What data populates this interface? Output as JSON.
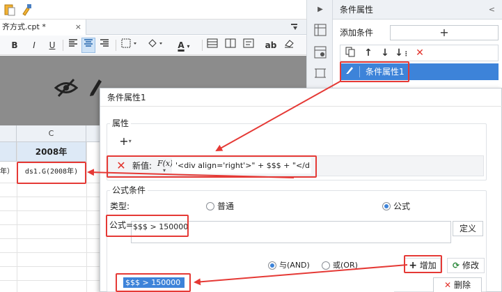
{
  "editor": {
    "file_tab": "齐方式.cpt *",
    "file_tab_close": "×",
    "format_toolbar": {
      "bold": "B",
      "italic": "I",
      "underline": "U",
      "font_color": "A",
      "ab": "ab"
    }
  },
  "sheet": {
    "column_c_header": "C",
    "left_cell_text": "年）",
    "header_cell": "2008年",
    "data_cell": "ds1.G(2008年)"
  },
  "right_panel": {
    "title": "条件属性",
    "collapse_glyph": "<",
    "add_condition_label": "添加条件",
    "add_button": "+",
    "toolbar": {
      "copy_icon": "copy-icon",
      "up": "↑",
      "down": "↓",
      "move_bottom": "↓",
      "delete": "✕"
    },
    "selected_item": "条件属性1"
  },
  "dialog": {
    "title": "条件属性1",
    "attribute_group_label": "属性",
    "add_attribute": "+",
    "new_value_label": "新值:",
    "fx_label": "F(x)",
    "new_value": "'<div align='right'>\" + $$$ + \"</div>\")",
    "formula_group_label": "公式条件",
    "type_label": "类型:",
    "type_options": [
      {
        "label": "普通",
        "selected": false
      },
      {
        "label": "公式",
        "selected": true
      }
    ],
    "formula_label": "公式=",
    "formula_value": "$$$ > 150000",
    "define_button": "定义",
    "logic_options": [
      {
        "label": "与(AND)",
        "selected": true
      },
      {
        "label": "或(OR)",
        "selected": false
      }
    ],
    "add_button": "增加",
    "modify_button": "修改",
    "condition_list_item": "$$$ > 150000",
    "delete_button": "删除"
  },
  "colors": {
    "accent_blue": "#3d83d9",
    "annotation_red": "#e53935",
    "cell_header_blue": "#dde9f6",
    "delete_red": "#e2312a"
  }
}
